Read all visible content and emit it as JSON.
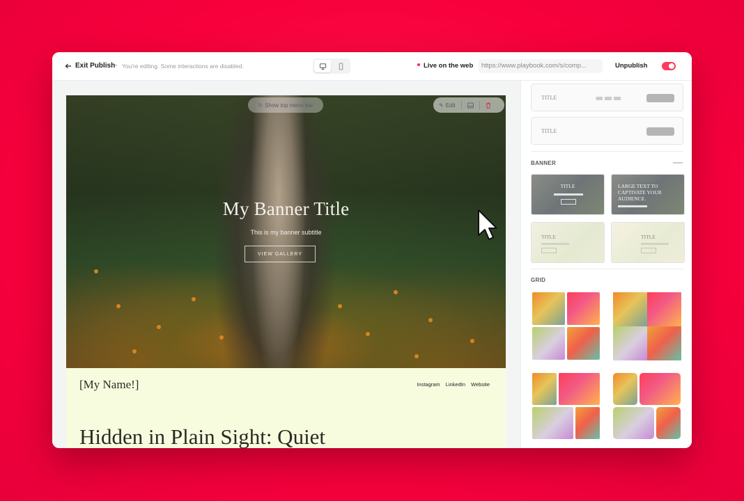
{
  "topbar": {
    "exit_label": "Exit Publish",
    "editing_note": "You're editing. Some interactions are disabled.",
    "live_label": "Live on the web",
    "url": "https://www.playbook.com/s/comp...",
    "unpublish_label": "Unpublish",
    "unpublish_toggle_on": true
  },
  "banner": {
    "menu_pill_label": "Show top menu bar",
    "edit_label": "Edit",
    "title": "My Banner Title",
    "subtitle": "This is my banner subtitle",
    "button_label": "VIEW GALLERY"
  },
  "page": {
    "site_name": "[My Name!]",
    "nav_links": [
      "Instagram",
      "LinkedIn",
      "Website"
    ],
    "heading": "Hidden in Plain Sight: Quiet"
  },
  "sidebar": {
    "nav_cards": [
      {
        "title": "TITLE"
      },
      {
        "title": "TITLE"
      }
    ],
    "banner_section": {
      "label": "BANNER",
      "tiles": [
        {
          "title": "TITLE"
        },
        {
          "title": "LARGE TEXT TO CAPTIVATE YOUR AUDIENCE."
        },
        {
          "title": "TITLE"
        },
        {
          "title": "TITLE"
        }
      ]
    },
    "grid_section": {
      "label": "GRID"
    }
  },
  "colors": {
    "background": "#f8003c",
    "accent": "#ff3a5c",
    "page_body": "#f8fcdf"
  }
}
